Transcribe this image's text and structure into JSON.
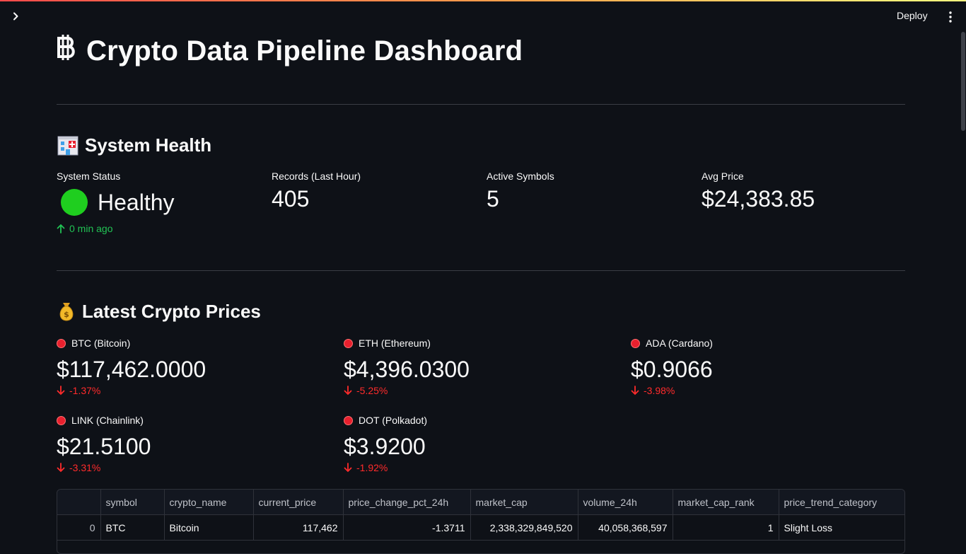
{
  "app": {
    "deploy_label": "Deploy"
  },
  "title": {
    "text": "Crypto Data Pipeline Dashboard",
    "icon": "bitcoin-symbol"
  },
  "system_health": {
    "heading": "System Health",
    "icon": "hospital-icon",
    "metrics": [
      {
        "label": "System Status",
        "value": "Healthy",
        "delta": "0 min ago",
        "status_color": "#1fce1f"
      },
      {
        "label": "Records (Last Hour)",
        "value": "405"
      },
      {
        "label": "Active Symbols",
        "value": "5"
      },
      {
        "label": "Avg Price",
        "value": "$24,383.85"
      }
    ]
  },
  "prices": {
    "heading": "Latest Crypto Prices",
    "icon": "money-bag-icon",
    "items": [
      {
        "label": "BTC (Bitcoin)",
        "value": "$117,462.0000",
        "delta": "-1.37%"
      },
      {
        "label": "ETH (Ethereum)",
        "value": "$4,396.0300",
        "delta": "-5.25%"
      },
      {
        "label": "ADA (Cardano)",
        "value": "$0.9066",
        "delta": "-3.98%"
      },
      {
        "label": "LINK (Chainlink)",
        "value": "$21.5100",
        "delta": "-3.31%"
      },
      {
        "label": "DOT (Polkadot)",
        "value": "$3.9200",
        "delta": "-1.92%"
      }
    ]
  },
  "table": {
    "columns": [
      "",
      "symbol",
      "crypto_name",
      "current_price",
      "price_change_pct_24h",
      "market_cap",
      "volume_24h",
      "market_cap_rank",
      "price_trend_category"
    ],
    "rows": [
      [
        "0",
        "BTC",
        "Bitcoin",
        "117,462",
        "-1.3711",
        "2,338,329,849,520",
        "40,058,368,597",
        "1",
        "Slight Loss"
      ]
    ]
  },
  "colors": {
    "accent_up": "#21c354",
    "accent_down": "#ff2b2b",
    "background": "#0e1117"
  }
}
